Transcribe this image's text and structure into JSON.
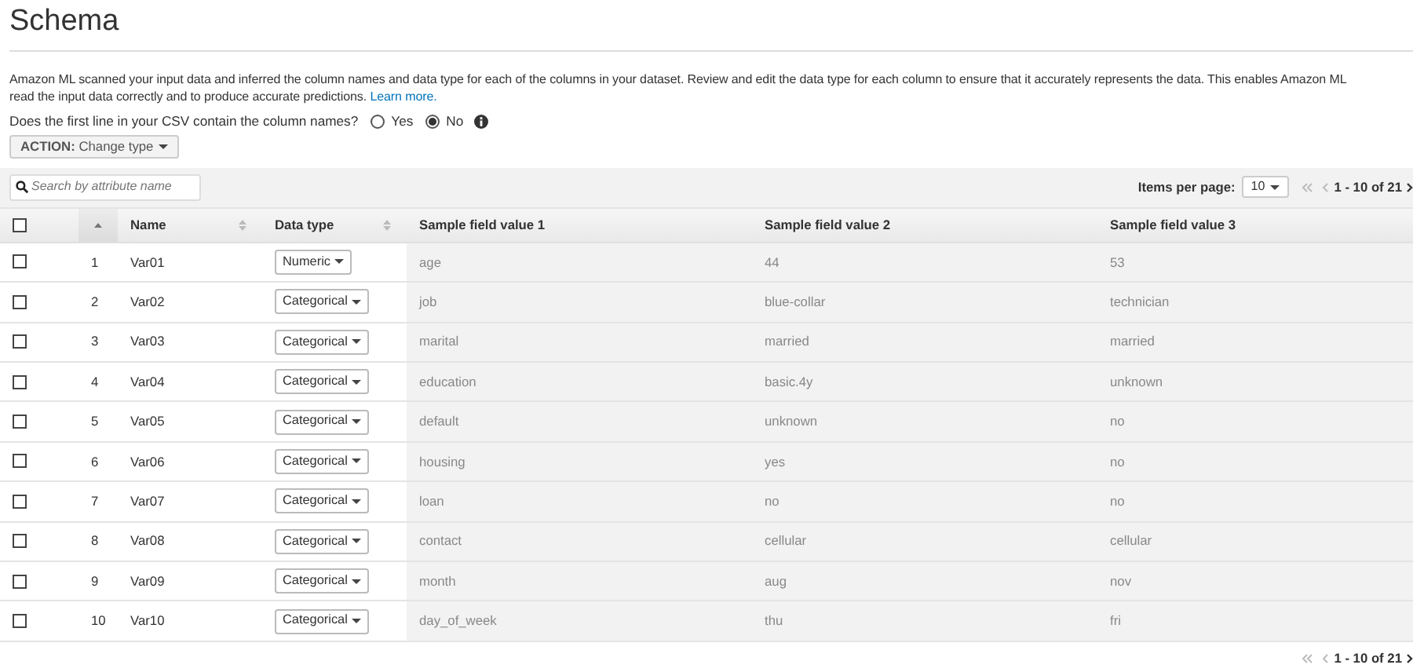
{
  "title": "Schema",
  "description": {
    "lines": [
      "Amazon ML scanned your input data and inferred the column names and data type for each of the columns in your dataset. Review and edit the data type for each column to ensure that it accurately represents the data. This enables Amazon ML",
      "read the input data correctly and to produce accurate predictions."
    ],
    "link": "Learn more."
  },
  "header_question": {
    "label": "Does the first line in your CSV contain the column names?",
    "options": [
      {
        "label": "Yes",
        "selected": false
      },
      {
        "label": "No",
        "selected": true
      }
    ]
  },
  "action_button": {
    "prefix": "ACTION:",
    "label": "Change type"
  },
  "search": {
    "placeholder": "Search by attribute name"
  },
  "items_per_page": {
    "label": "Items per page:",
    "value": "10"
  },
  "pager": "1 - 10 of 21",
  "select_all": {
    "checked": false
  },
  "columns": [
    "",
    "Name",
    "Data type",
    "Sample field value 1",
    "Sample field value 2",
    "Sample field value 3"
  ],
  "rows": [
    {
      "checked": false,
      "index": "1",
      "name": "Var01",
      "type": "Numeric",
      "values": [
        "age",
        "44",
        "53"
      ]
    },
    {
      "checked": false,
      "index": "2",
      "name": "Var02",
      "type": "Categorical",
      "values": [
        "job",
        "blue-collar",
        "technician"
      ]
    },
    {
      "checked": false,
      "index": "3",
      "name": "Var03",
      "type": "Categorical",
      "values": [
        "marital",
        "married",
        "married"
      ]
    },
    {
      "checked": false,
      "index": "4",
      "name": "Var04",
      "type": "Categorical",
      "values": [
        "education",
        "basic.4y",
        "unknown"
      ]
    },
    {
      "checked": false,
      "index": "5",
      "name": "Var05",
      "type": "Categorical",
      "values": [
        "default",
        "unknown",
        "no"
      ]
    },
    {
      "checked": false,
      "index": "6",
      "name": "Var06",
      "type": "Categorical",
      "values": [
        "housing",
        "yes",
        "no"
      ]
    },
    {
      "checked": false,
      "index": "7",
      "name": "Var07",
      "type": "Categorical",
      "values": [
        "loan",
        "no",
        "no"
      ]
    },
    {
      "checked": false,
      "index": "8",
      "name": "Var08",
      "type": "Categorical",
      "values": [
        "contact",
        "cellular",
        "cellular"
      ]
    },
    {
      "checked": false,
      "index": "9",
      "name": "Var09",
      "type": "Categorical",
      "values": [
        "month",
        "aug",
        "nov"
      ]
    },
    {
      "checked": false,
      "index": "10",
      "name": "Var10",
      "type": "Categorical",
      "values": [
        "day_of_week",
        "thu",
        "fri"
      ]
    }
  ],
  "bottom_pager": "1 - 10 of 21"
}
